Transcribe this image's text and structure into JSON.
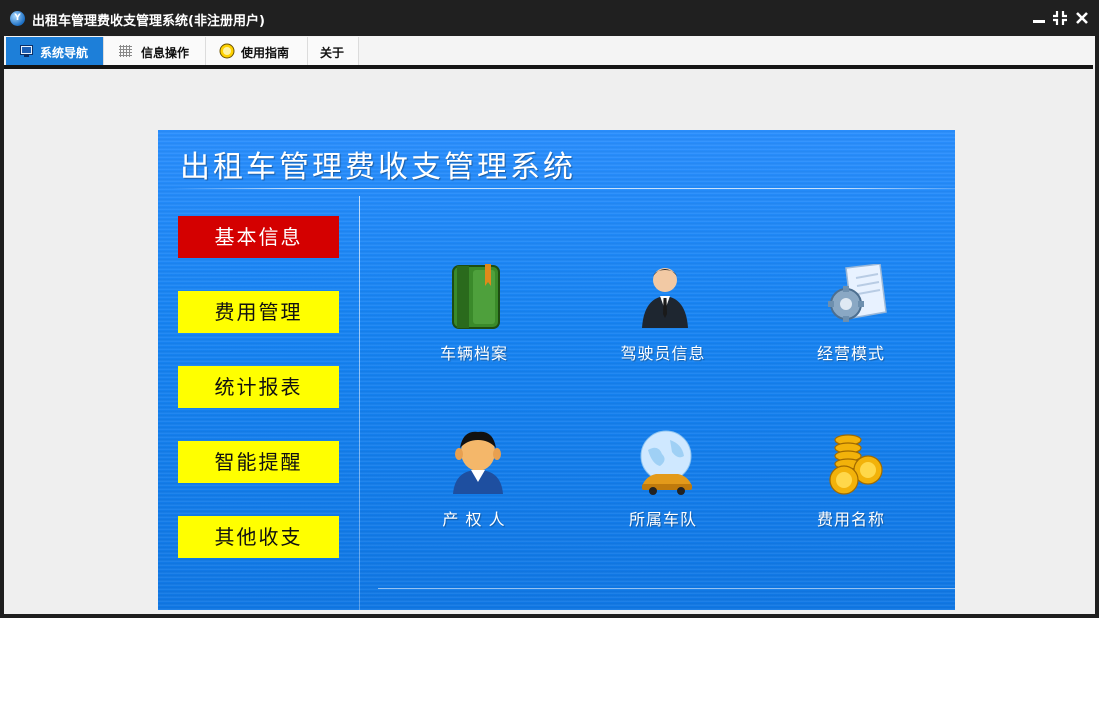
{
  "window": {
    "title": "出租车管理费收支管理系统(非注册用户)",
    "icon": "app-logo-icon",
    "controls": [
      "minimize-icon",
      "restore-icon",
      "close-icon"
    ]
  },
  "tabs": [
    {
      "label": "系统导航",
      "icon": "monitor-icon",
      "active": true
    },
    {
      "label": "信息操作",
      "icon": "grid-icon",
      "active": false
    },
    {
      "label": "使用指南",
      "icon": "lightbulb-icon",
      "active": false
    },
    {
      "label": "关于",
      "icon": "",
      "active": false
    }
  ],
  "panel": {
    "title": "出租车管理费收支管理系统",
    "sidebar": [
      {
        "label": "基本信息",
        "active": true
      },
      {
        "label": "费用管理",
        "active": false
      },
      {
        "label": "统计报表",
        "active": false
      },
      {
        "label": "智能提醒",
        "active": false
      },
      {
        "label": "其他收支",
        "active": false
      }
    ],
    "tiles": [
      {
        "label": "车辆档案",
        "icon": "green-book-icon"
      },
      {
        "label": "驾驶员信息",
        "icon": "businessman-icon"
      },
      {
        "label": "经营模式",
        "icon": "gear-document-icon"
      },
      {
        "label": "产 权 人",
        "icon": "person-avatar-icon"
      },
      {
        "label": "所属车队",
        "icon": "globe-car-icon"
      },
      {
        "label": "费用名称",
        "icon": "gold-coins-icon"
      }
    ]
  },
  "colors": {
    "panel_blue": "#1684f4",
    "sidebar_button": "#ffff00",
    "sidebar_button_active": "#d40000",
    "tab_active": "#1d7fd9",
    "titlebar": "#202020"
  }
}
